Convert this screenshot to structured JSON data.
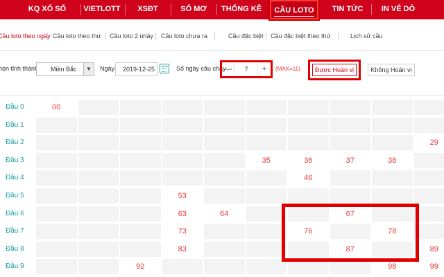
{
  "colors": {
    "brand_red": "#d0021b",
    "teal": "#1a9e9e",
    "number_red": "#e53935",
    "highlight_box": "#e00000"
  },
  "nav": {
    "items": [
      {
        "label": "KQ XỔ SỐ"
      },
      {
        "label": "VIETLOTT"
      },
      {
        "label": "XSĐT"
      },
      {
        "label": "SỔ MƠ"
      },
      {
        "label": "THỐNG KÊ"
      },
      {
        "label": "CẦU LOTO",
        "active": true
      },
      {
        "label": "TIN TỨC"
      },
      {
        "label": "IN VÉ DÒ"
      }
    ]
  },
  "subnav": {
    "items": [
      {
        "label": "Cầu loto theo ngày",
        "active": true
      },
      {
        "label": "Cầu loto theo thứ"
      },
      {
        "label": "Cầu loto 2 nháy"
      },
      {
        "label": "Cầu loto chưa ra"
      },
      {
        "label": "Cầu đặc biệt"
      },
      {
        "label": "Cầu đặc biệt theo thứ"
      },
      {
        "label": "Lịch sử cầu"
      }
    ]
  },
  "filter": {
    "province_label": "họn tỉnh thành",
    "province_value": "Miền Bắc",
    "date_label": "Ngày",
    "date_value": "2019-12-25",
    "days_label": "Số ngày cầu chạy",
    "days_value": "7",
    "minus": "—",
    "plus": "+",
    "max_note": "(MAX=11)",
    "hoan_vi_button": "Được Hoán vị",
    "khong_hoan_vi_button": "Không Hoán vị"
  },
  "grid": {
    "rows": [
      {
        "label": "Đầu 0",
        "cells": [
          "00",
          "",
          "",
          "",
          "",
          "",
          "",
          "",
          "",
          ""
        ]
      },
      {
        "label": "Đầu 1",
        "cells": [
          "",
          "",
          "",
          "",
          "",
          "",
          "",
          "",
          "",
          ""
        ]
      },
      {
        "label": "Đầu 2",
        "cells": [
          "",
          "",
          "",
          "",
          "",
          "",
          "",
          "",
          "",
          "29"
        ]
      },
      {
        "label": "Đầu 3",
        "cells": [
          "",
          "",
          "",
          "",
          "",
          "35",
          "36",
          "37",
          "38",
          ""
        ]
      },
      {
        "label": "Đầu 4",
        "cells": [
          "",
          "",
          "",
          "",
          "",
          "",
          "46",
          "",
          "",
          ""
        ]
      },
      {
        "label": "Đầu 5",
        "cells": [
          "",
          "",
          "",
          "53",
          "",
          "",
          "",
          "",
          "",
          ""
        ]
      },
      {
        "label": "Đầu 6",
        "cells": [
          "",
          "",
          "",
          "63",
          "64",
          "",
          "",
          "67",
          "",
          ""
        ]
      },
      {
        "label": "Đầu 7",
        "cells": [
          "",
          "",
          "",
          "73",
          "",
          "",
          "76",
          "",
          "78",
          ""
        ]
      },
      {
        "label": "Đầu 8",
        "cells": [
          "",
          "",
          "",
          "83",
          "",
          "",
          "",
          "87",
          "",
          "89"
        ]
      },
      {
        "label": "Đầu 9",
        "cells": [
          "",
          "",
          "92",
          "",
          "",
          "",
          "",
          "",
          "98",
          "99"
        ]
      }
    ]
  }
}
